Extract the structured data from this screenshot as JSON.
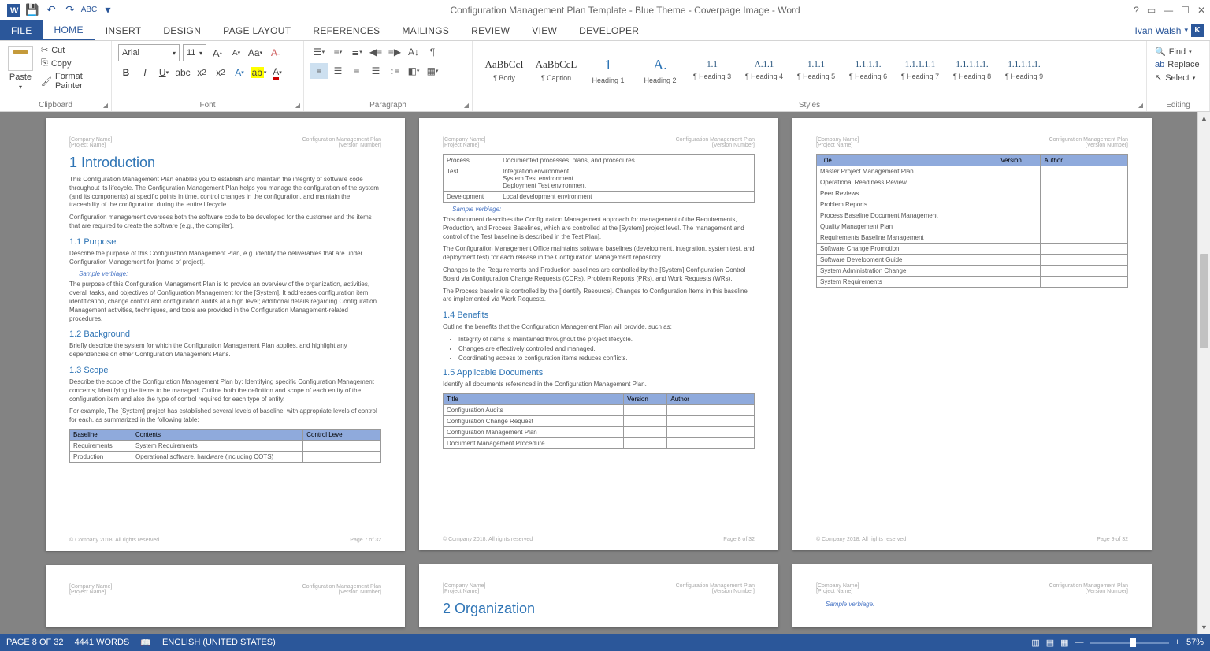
{
  "title": "Configuration Management Plan Template - Blue Theme - Coverpage Image - Word",
  "user": {
    "name": "Ivan Walsh",
    "badge": "K"
  },
  "tabs": [
    "FILE",
    "HOME",
    "INSERT",
    "DESIGN",
    "PAGE LAYOUT",
    "REFERENCES",
    "MAILINGS",
    "REVIEW",
    "VIEW",
    "DEVELOPER"
  ],
  "clipboard": {
    "paste": "Paste",
    "cut": "Cut",
    "copy": "Copy",
    "painter": "Format Painter",
    "label": "Clipboard"
  },
  "font": {
    "name": "Arial",
    "size": "11",
    "label": "Font"
  },
  "paragraph": {
    "label": "Paragraph"
  },
  "styles": {
    "label": "Styles",
    "items": [
      {
        "preview": "AaBbCcI",
        "name": "¶ Body",
        "cls": ""
      },
      {
        "preview": "AaBbCcL",
        "name": "¶ Caption",
        "cls": ""
      },
      {
        "preview": "1",
        "name": "Heading 1",
        "cls": "sp-h1"
      },
      {
        "preview": "A.",
        "name": "Heading 2",
        "cls": "sp-h1"
      },
      {
        "preview": "1.1",
        "name": "¶ Heading 3",
        "cls": "sp-num"
      },
      {
        "preview": "A.1.1",
        "name": "¶ Heading 4",
        "cls": "sp-num"
      },
      {
        "preview": "1.1.1",
        "name": "¶ Heading 5",
        "cls": "sp-num"
      },
      {
        "preview": "1.1.1.1.",
        "name": "¶ Heading 6",
        "cls": "sp-num"
      },
      {
        "preview": "1.1.1.1.1",
        "name": "¶ Heading 7",
        "cls": "sp-num"
      },
      {
        "preview": "1.1.1.1.1.",
        "name": "¶ Heading 8",
        "cls": "sp-num"
      },
      {
        "preview": "1.1.1.1.1.",
        "name": "¶ Heading 9",
        "cls": "sp-num"
      }
    ]
  },
  "editing": {
    "find": "Find",
    "replace": "Replace",
    "select": "Select",
    "label": "Editing"
  },
  "header": {
    "company": "[Company Name]",
    "project": "[Project Name]",
    "doc": "Configuration Management Plan",
    "ver": "[Version Number]"
  },
  "footer": {
    "copy": "© Company 2018. All rights reserved",
    "p7": "Page 7 of 32",
    "p8": "Page 8 of 32",
    "p9": "Page 9 of 32"
  },
  "p1": {
    "h1": "1    Introduction",
    "intro1": "This Configuration Management Plan enables you to establish and maintain the integrity of software code throughout its lifecycle. The Configuration Management Plan helps you manage the configuration of the system (and its components) at specific points in time, control changes in the configuration, and maintain the traceability of the configuration during the entire lifecycle.",
    "intro2": "Configuration management oversees both the software code to be developed for the customer and the items that are required to create the software (e.g., the compiler).",
    "h11": "1.1    Purpose",
    "purpose1": "Describe the purpose of this Configuration Management Plan, e.g. identify the deliverables that are under Configuration Management for [name of project].",
    "verbiage": "Sample verbiage:",
    "purpose2": "The purpose of this Configuration Management Plan is to provide an overview of the organization, activities, overall tasks, and objectives of Configuration Management for the [System].  It addresses configuration item identification, change control and configuration audits at a high level; additional details regarding Configuration Management activities, techniques, and tools are provided in the Configuration Management-related procedures.",
    "h12": "1.2    Background",
    "bg": "Briefly describe the system for which the Configuration Management Plan applies, and highlight any dependencies on other Configuration Management Plans.",
    "h13": "1.3    Scope",
    "scope1": "Describe the scope of the Configuration Management Plan by: Identifying specific Configuration Management concerns; Identifying the items to be managed; Outline both the definition and scope of each entity of the configuration item and also the type of control required for each type of entity.",
    "scope2": "For example, The [System] project has established several levels of baseline, with appropriate levels of control for each, as summarized in the following table:",
    "tbl1": {
      "headers": [
        "Baseline",
        "Contents",
        "Control Level"
      ],
      "rows": [
        [
          "Requirements",
          "System Requirements",
          ""
        ],
        [
          "Production",
          "Operational software, hardware (including COTS)",
          ""
        ]
      ]
    }
  },
  "p2": {
    "tbl1": {
      "rows": [
        [
          "Process",
          "Documented processes, plans, and procedures"
        ],
        [
          "Test",
          "Integration environment\nSystem Test environment\nDeployment Test environment"
        ],
        [
          "Development",
          "Local development environment"
        ]
      ]
    },
    "verbiage": "Sample verbiage:",
    "para1": "This document describes the Configuration Management approach for management of the Requirements, Production, and Process Baselines, which are controlled at the [System] project level. The management and control of the Test baseline is described in the Test Plan].",
    "para2": "The Configuration Management Office maintains software baselines (development, integration, system test, and deployment test) for each release in the Configuration Management repository.",
    "para3": "Changes to the Requirements and Production baselines are controlled by the [System] Configuration Control Board via Configuration Change Requests (CCRs), Problem Reports (PRs), and Work Requests (WRs).",
    "para4": "The Process baseline is controlled by the [Identify Resource]. Changes to Configuration Items in this baseline are implemented via Work Requests.",
    "h14": "1.4    Benefits",
    "ben1": "Outline the benefits that the Configuration Management Plan will provide, such as:",
    "bullets": [
      "Integrity of items is maintained throughout the project lifecycle.",
      "Changes are effectively controlled and managed.",
      "Coordinating access to configuration items reduces conflicts."
    ],
    "h15": "1.5    Applicable Documents",
    "docs1": "Identify all documents referenced in the Configuration Management Plan.",
    "tbl2": {
      "headers": [
        "Title",
        "Version",
        "Author"
      ],
      "rows": [
        [
          "Configuration Audits",
          "",
          ""
        ],
        [
          "Configuration Change Request",
          "",
          ""
        ],
        [
          "Configuration Management Plan",
          "",
          ""
        ],
        [
          "Document Management Procedure",
          "",
          ""
        ]
      ]
    }
  },
  "p3": {
    "tbl": {
      "headers": [
        "Title",
        "Version",
        "Author"
      ],
      "rows": [
        [
          "Master Project Management Plan",
          "",
          ""
        ],
        [
          "Operational Readiness Review",
          "",
          ""
        ],
        [
          "Peer Reviews",
          "",
          ""
        ],
        [
          "Problem Reports",
          "",
          ""
        ],
        [
          "Process Baseline Document Management",
          "",
          ""
        ],
        [
          "Quality Management Plan",
          "",
          ""
        ],
        [
          "Requirements Baseline Management",
          "",
          ""
        ],
        [
          "Software Change Promotion",
          "",
          ""
        ],
        [
          "Software Development Guide",
          "",
          ""
        ],
        [
          "System Administration Change",
          "",
          ""
        ],
        [
          "System Requirements",
          "",
          ""
        ]
      ]
    }
  },
  "p5": {
    "h2": "2    Organization",
    "verbiage": "Sample verbiage:"
  },
  "status": {
    "page": "PAGE 8 OF 32",
    "words": "4441 WORDS",
    "lang": "ENGLISH (UNITED STATES)",
    "zoom": "57%"
  }
}
